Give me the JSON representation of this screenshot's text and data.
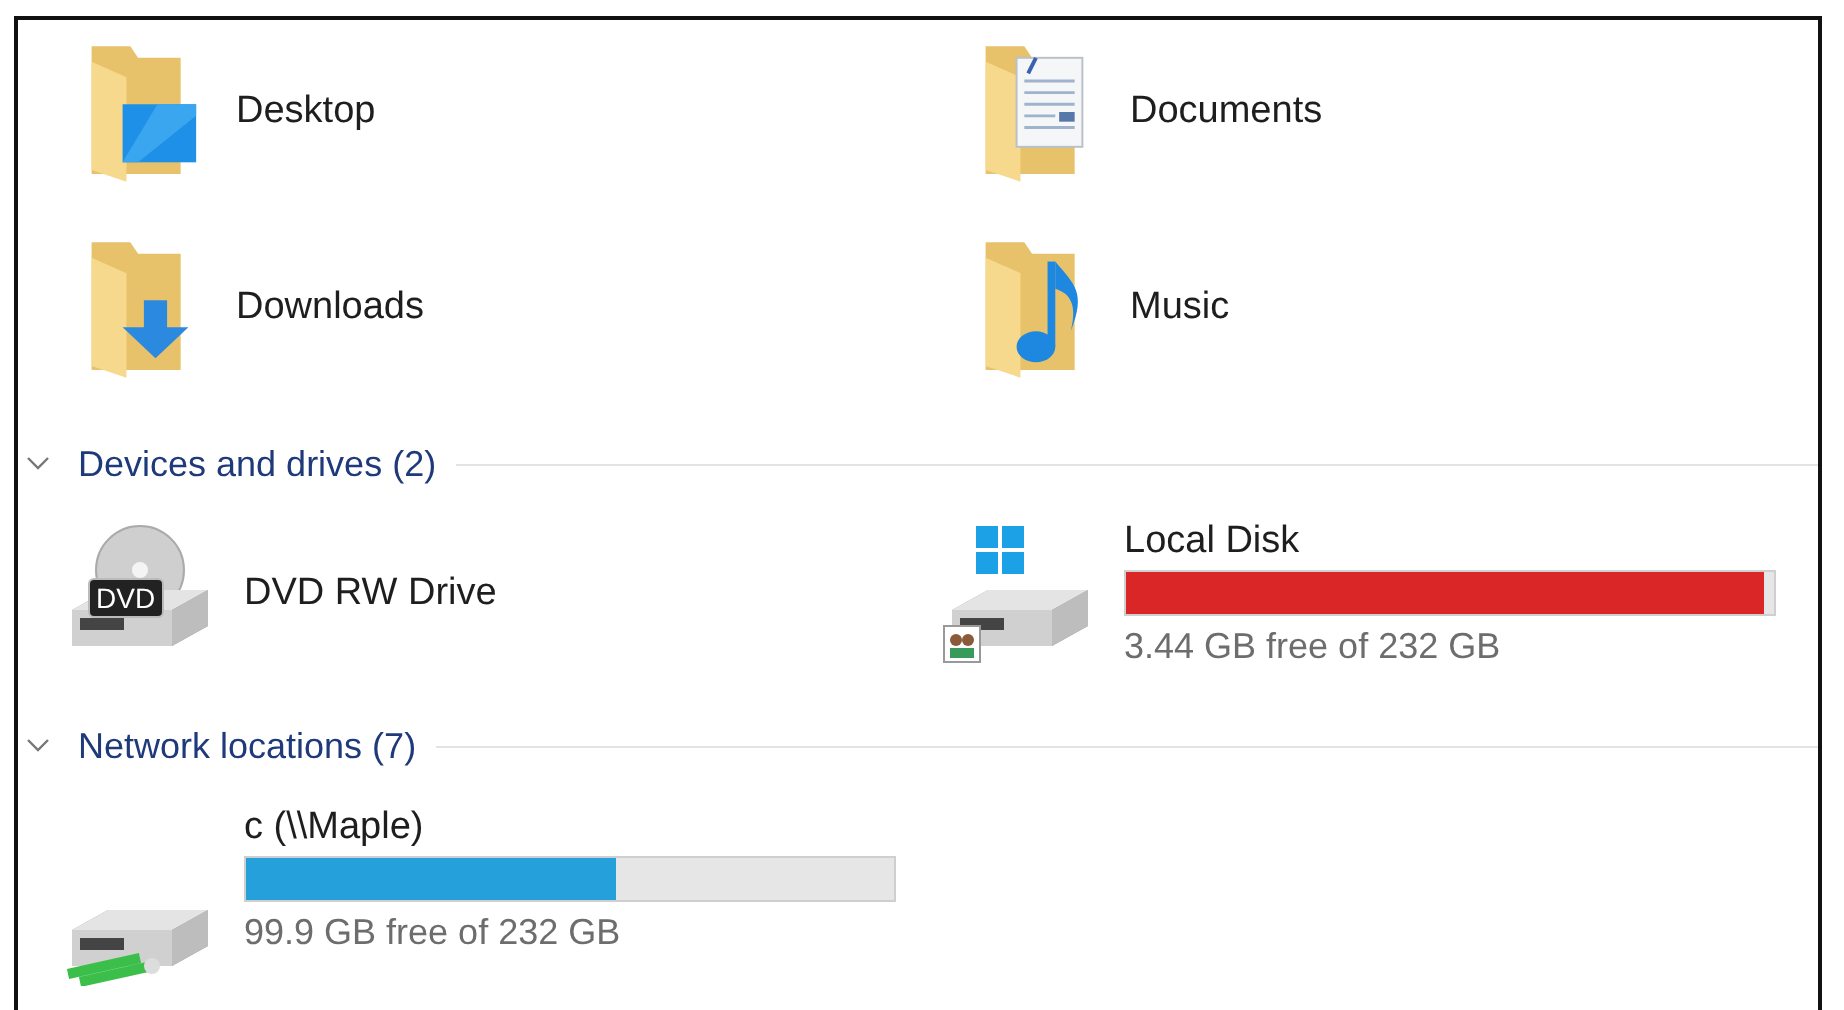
{
  "folders": [
    {
      "kind": "desktop",
      "name": "Desktop"
    },
    {
      "kind": "documents",
      "name": "Documents"
    },
    {
      "kind": "downloads",
      "name": "Downloads"
    },
    {
      "kind": "music",
      "name": "Music"
    }
  ],
  "sections": [
    {
      "title": "Devices and drives (2)",
      "expanded": true,
      "items": [
        {
          "kind": "dvd",
          "name": "DVD RW Drive",
          "badge": "DVD"
        },
        {
          "kind": "system",
          "name": "Local Disk",
          "level": 0.985,
          "warning": true,
          "space": "3.44 GB free of 232 GB"
        }
      ]
    },
    {
      "title": "Network locations (7)",
      "expanded": true,
      "items": [
        {
          "kind": "network",
          "name": "c (\\\\Maple)",
          "level": 0.57,
          "warning": false,
          "space": "99.9 GB free of 232 GB"
        }
      ]
    }
  ]
}
